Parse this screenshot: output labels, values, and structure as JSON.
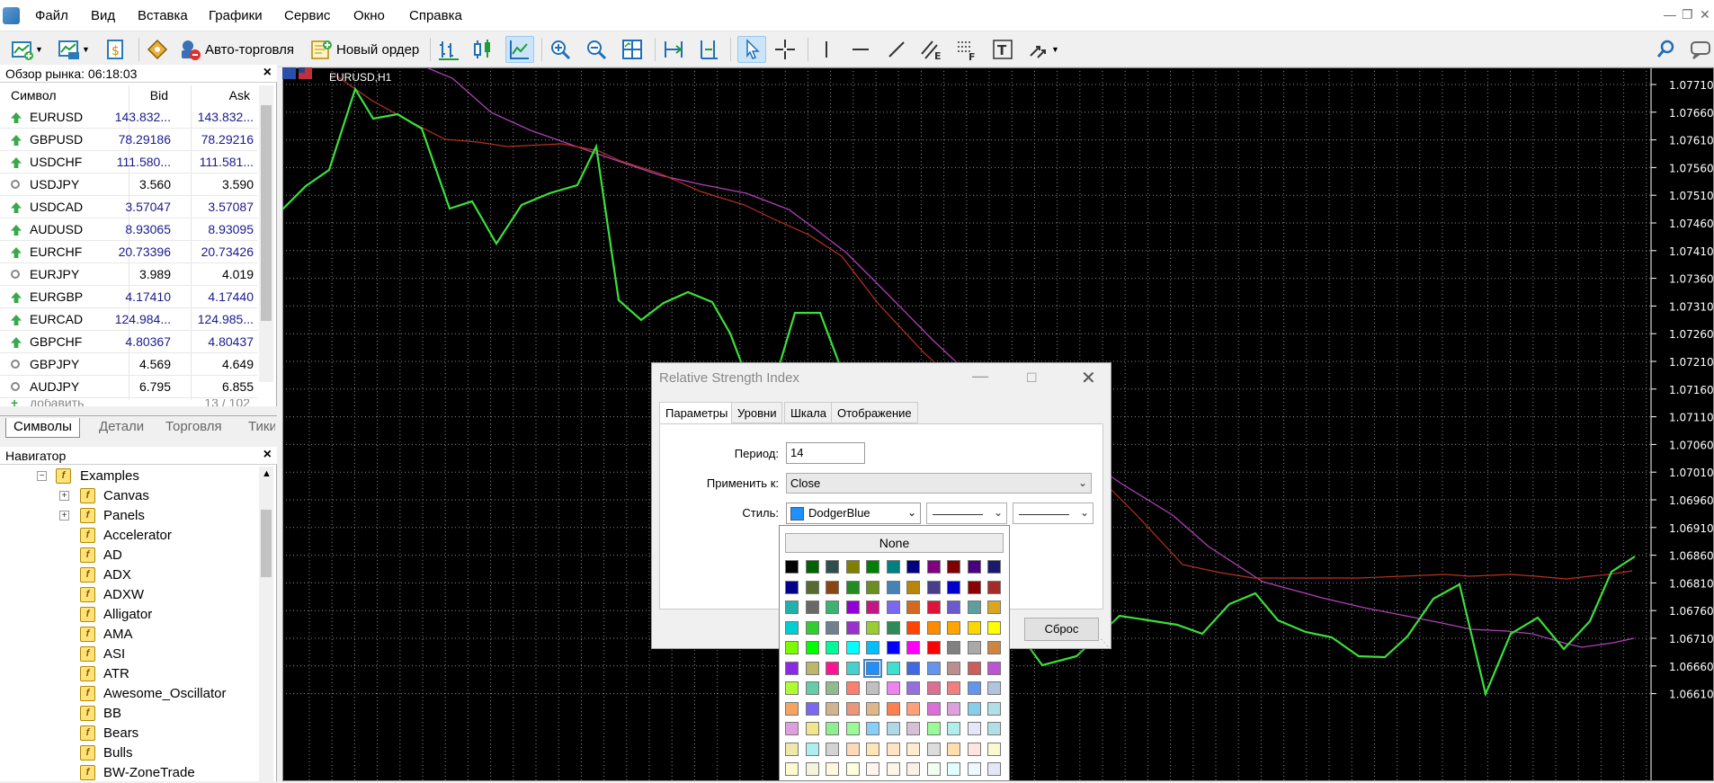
{
  "menubar": {
    "items": [
      "Файл",
      "Вид",
      "Вставка",
      "Графики",
      "Сервис",
      "Окно",
      "Справка"
    ]
  },
  "toolbar": {
    "auto_trading": "Авто-торговля",
    "new_order": "Новый ордер"
  },
  "market_watch": {
    "title": "Обзор рынка: 06:18:03",
    "columns": {
      "symbol": "Символ",
      "bid": "Bid",
      "ask": "Ask"
    },
    "rows": [
      {
        "symbol": "EURUSD",
        "bid": "143.832...",
        "ask": "143.832...",
        "dir": "up"
      },
      {
        "symbol": "GBPUSD",
        "bid": "78.29186",
        "ask": "78.29216",
        "dir": "up"
      },
      {
        "symbol": "USDCHF",
        "bid": "111.580...",
        "ask": "111.581...",
        "dir": "up"
      },
      {
        "symbol": "USDJPY",
        "bid": "3.560",
        "ask": "3.590",
        "dir": "none"
      },
      {
        "symbol": "USDCAD",
        "bid": "3.57047",
        "ask": "3.57087",
        "dir": "up"
      },
      {
        "symbol": "AUDUSD",
        "bid": "8.93065",
        "ask": "8.93095",
        "dir": "up"
      },
      {
        "symbol": "EURCHF",
        "bid": "20.73396",
        "ask": "20.73426",
        "dir": "up"
      },
      {
        "symbol": "EURJPY",
        "bid": "3.989",
        "ask": "4.019",
        "dir": "none"
      },
      {
        "symbol": "EURGBP",
        "bid": "4.17410",
        "ask": "4.17440",
        "dir": "up"
      },
      {
        "symbol": "EURCAD",
        "bid": "124.984...",
        "ask": "124.985...",
        "dir": "up"
      },
      {
        "symbol": "GBPCHF",
        "bid": "4.80367",
        "ask": "4.80437",
        "dir": "up"
      },
      {
        "symbol": "GBPJPY",
        "bid": "4.569",
        "ask": "4.649",
        "dir": "none"
      },
      {
        "symbol": "AUDJPY",
        "bid": "6.795",
        "ask": "6.855",
        "dir": "none"
      }
    ],
    "add_label": "добавить",
    "count": "13 / 102",
    "tabs": [
      "Символы",
      "Детали",
      "Торговля",
      "Тики"
    ]
  },
  "navigator": {
    "title": "Навигатор",
    "folder": "Examples",
    "items": [
      "Canvas",
      "Panels",
      "Accelerator",
      "AD",
      "ADX",
      "ADXW",
      "Alligator",
      "AMA",
      "ASI",
      "ATR",
      "Awesome_Oscillator",
      "BB",
      "Bears",
      "Bulls",
      "BW-ZoneTrade"
    ]
  },
  "chart": {
    "symbol": "EURUSD,H1",
    "price_labels": [
      "1.07710",
      "1.07660",
      "1.07610",
      "1.07560",
      "1.07510",
      "1.07460",
      "1.07410",
      "1.07360",
      "1.07310",
      "1.07260",
      "1.07210",
      "1.07160",
      "1.07110",
      "1.07060",
      "1.07010",
      "1.06960",
      "1.06910",
      "1.06860",
      "1.06810",
      "1.06760",
      "1.06710",
      "1.06660",
      "1.06610"
    ],
    "colors": {
      "price": "#3be03b",
      "ma_fast": "#b83220",
      "ma_slow": "#b040b8",
      "grid": "#8a8a8a"
    }
  },
  "dialog": {
    "title": "Relative Strength Index",
    "tabs": [
      "Параметры",
      "Уровни",
      "Шкала",
      "Отображение"
    ],
    "period_label": "Период:",
    "period_value": "14",
    "apply_label": "Применить к:",
    "apply_value": "Close",
    "style_label": "Стиль:",
    "color_value": "DodgerBlue",
    "reset_button": "Сброс"
  },
  "palette": {
    "none_label": "None",
    "colors": [
      [
        "#000000",
        "#006400",
        "#2f4f4f",
        "#808000",
        "#008000",
        "#008080",
        "#000080",
        "#800080",
        "#800000",
        "#4b0082",
        "#191970"
      ],
      [
        "#00008b",
        "#556b2f",
        "#8b4513",
        "#228b22",
        "#6b8e23",
        "#4682b4",
        "#b8860b",
        "#483d8b",
        "#0000cd",
        "#8b0000",
        "#a52a2a"
      ],
      [
        "#20b2aa",
        "#696969",
        "#3cb371",
        "#9400d3",
        "#c71585",
        "#7b68ee",
        "#d2691e",
        "#dc143c",
        "#6a5acd",
        "#5f9ea0",
        "#daa520"
      ],
      [
        "#00ced1",
        "#32cd32",
        "#708090",
        "#9932cc",
        "#9acd32",
        "#2e8b57",
        "#ff4500",
        "#ff8c00",
        "#ffa500",
        "#ffd700",
        "#ffff00"
      ],
      [
        "#7cfc00",
        "#00ff00",
        "#00fa9a",
        "#00ffff",
        "#00bfff",
        "#0000ff",
        "#ff00ff",
        "#ff0000",
        "#808080",
        "#a9a9a9",
        "#cd853f"
      ],
      [
        "#8a2be2",
        "#bdb76b",
        "#ff1493",
        "#48d1cc",
        "#1e90ff",
        "#40e0d0",
        "#4169e1",
        "#6495ed",
        "#bc8f8f",
        "#cd5c5c",
        "#ba55d3"
      ],
      [
        "#adff2f",
        "#66cdaa",
        "#8fbc8f",
        "#fa8072",
        "#c0c0c0",
        "#ee82ee",
        "#9370db",
        "#db7093",
        "#f08080",
        "#6495ed",
        "#b0c4de"
      ],
      [
        "#f4a460",
        "#7b68ee",
        "#d2b48c",
        "#e9967a",
        "#deb887",
        "#ff7f50",
        "#ffa07a",
        "#da70d6",
        "#dda0dd",
        "#87ceeb",
        "#b0e0e6"
      ],
      [
        "#dda0dd",
        "#f0e68c",
        "#90ee90",
        "#98fb98",
        "#87cefa",
        "#add8e6",
        "#d8bfd8",
        "#98fb98",
        "#afeeee",
        "#e6e6fa",
        "#b0e0e6"
      ],
      [
        "#eee8aa",
        "#afeeee",
        "#d3d3d3",
        "#ffdab9",
        "#ffe4b5",
        "#ffe4c4",
        "#ffebcd",
        "#dcdcdc",
        "#ffdead",
        "#ffe4e1",
        "#fafad2"
      ],
      [
        "#fffacd",
        "#f5f5dc",
        "#fff8dc",
        "#ffffe0",
        "#fff5ee",
        "#fdf5e6",
        "#faf0e6",
        "#f0fff0",
        "#e0ffff",
        "#f0f8ff",
        "#e6e6fa"
      ]
    ]
  }
}
